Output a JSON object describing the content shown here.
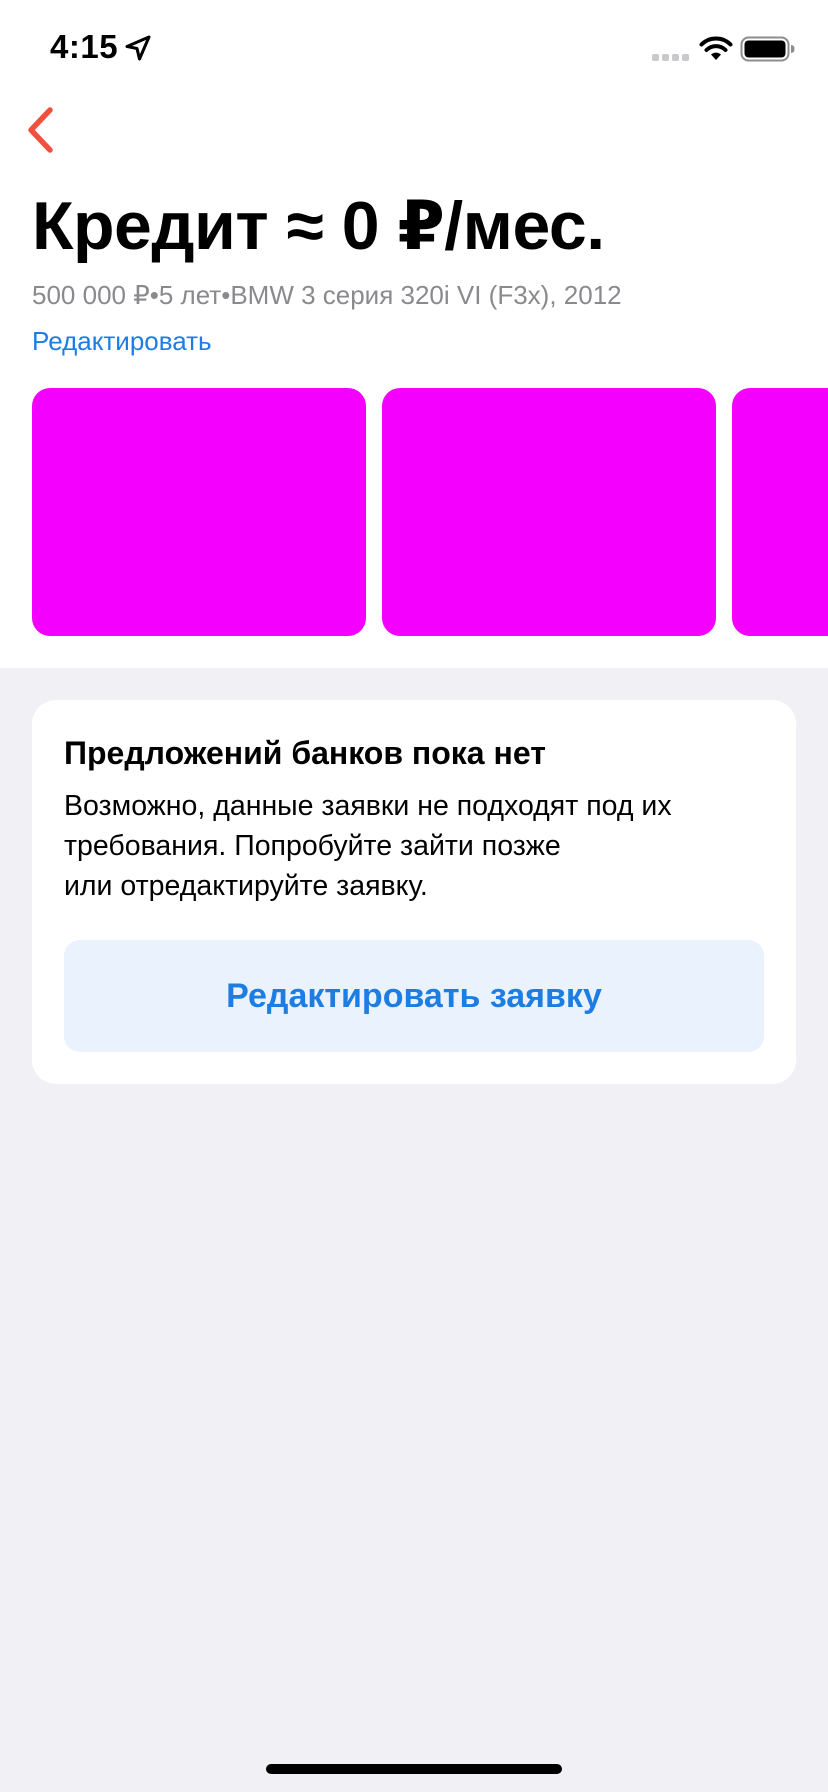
{
  "status_bar": {
    "time": "4:15",
    "icons": [
      "location-arrow-icon",
      "signal-icon",
      "wifi-icon",
      "battery-icon"
    ]
  },
  "nav": {
    "back_icon": "chevron-left-icon",
    "back_color": "#F1503F"
  },
  "header": {
    "title": "Кредит ≈ 0 ₽/мес.",
    "subtitle": "500 000 ₽•5 лет•BMW 3 серия 320i VI (F3x), 2012",
    "edit_link": "Редактировать"
  },
  "carousel": {
    "card_color": "#F400FF",
    "cards": [
      "",
      "",
      ""
    ]
  },
  "info_card": {
    "title": "Предложений банков пока нет",
    "text_lines": [
      "Возможно, данные заявки не подходят под их",
      "требования. Попробуйте зайти позже",
      "или отредактируйте заявку."
    ],
    "button_label": "Редактировать заявку"
  },
  "colors": {
    "accent": "#1E7DE3",
    "background": "#F1F1F5",
    "button_bg": "#E9F2FD"
  }
}
